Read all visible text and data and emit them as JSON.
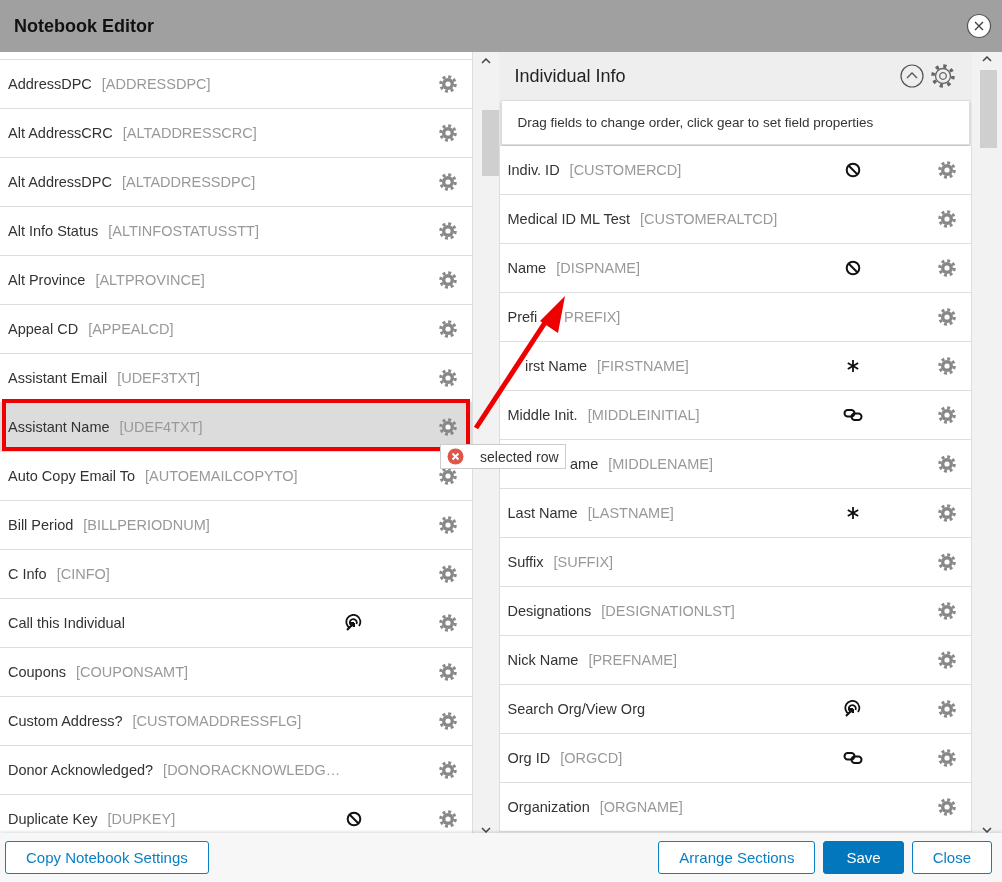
{
  "window": {
    "title": "Notebook Editor"
  },
  "available_fields": [
    {
      "label": "AddressDPC",
      "code": "[ADDRESSDPC]",
      "kind": "plain",
      "selected": false
    },
    {
      "label": "Alt AddressCRC",
      "code": "[ALTADDRESSCRC]",
      "kind": "plain",
      "selected": false
    },
    {
      "label": "Alt AddressDPC",
      "code": "[ALTADDRESSDPC]",
      "kind": "plain",
      "selected": false
    },
    {
      "label": "Alt Info Status",
      "code": "[ALTINFOSTATUSSTT]",
      "kind": "plain",
      "selected": false
    },
    {
      "label": "Alt Province",
      "code": "[ALTPROVINCE]",
      "kind": "plain",
      "selected": false
    },
    {
      "label": "Appeal CD",
      "code": "[APPEALCD]",
      "kind": "plain",
      "selected": false
    },
    {
      "label": "Assistant Email",
      "code": "[UDEF3TXT]",
      "kind": "plain",
      "selected": false
    },
    {
      "label": "Assistant Name",
      "code": "[UDEF4TXT]",
      "kind": "plain",
      "selected": true
    },
    {
      "label": "Auto Copy Email To",
      "code": "[AUTOEMAILCOPYTO]",
      "kind": "plain",
      "selected": false
    },
    {
      "label": "Bill Period",
      "code": "[BILLPERIODNUM]",
      "kind": "plain",
      "selected": false
    },
    {
      "label": "C Info",
      "code": "[CINFO]",
      "kind": "plain",
      "selected": false
    },
    {
      "label": "Call this Individual",
      "kind": "lookup",
      "selected": false
    },
    {
      "label": "Coupons",
      "code": "[COUPONSAMT]",
      "kind": "plain",
      "selected": false
    },
    {
      "label": "Custom Address?",
      "code": "[CUSTOMADDRESSFLG]",
      "kind": "plain",
      "selected": false
    },
    {
      "label": "Donor Acknowledged?",
      "code": "[DONORACKNOWLEDG…",
      "kind": "plain",
      "selected": false
    },
    {
      "label": "Duplicate Key",
      "code": "[DUPKEY]",
      "kind": "readonly",
      "selected": false
    }
  ],
  "section": {
    "title": "Individual Info",
    "expanded": true,
    "hint": "Drag fields to change order, click gear to set field properties",
    "fields": [
      {
        "label": "Indiv. ID",
        "code": "[CUSTOMERCD]",
        "kind": "readonly"
      },
      {
        "label": "Medical ID ML Test",
        "code": "[CUSTOMERALTCD]",
        "kind": "plain"
      },
      {
        "label": "Name",
        "code": "[DISPNAME]",
        "kind": "readonly"
      },
      {
        "label": "Prefi",
        "code": "PREFIX]",
        "kind": "plain"
      },
      {
        "label": "irst Name",
        "code": "[FIRSTNAME]",
        "kind": "required"
      },
      {
        "label": "Middle Init.",
        "code": "[MIDDLEINITIAL]",
        "kind": "linked"
      },
      {
        "label": "ame",
        "code": "[MIDDLENAME]",
        "kind": "plain"
      },
      {
        "label": "Last Name",
        "code": "[LASTNAME]",
        "kind": "required"
      },
      {
        "label": "Suffix",
        "code": "[SUFFIX]",
        "kind": "plain"
      },
      {
        "label": "Designations",
        "code": "[DESIGNATIONLST]",
        "kind": "plain"
      },
      {
        "label": "Nick Name",
        "code": "[PREFNAME]",
        "kind": "plain"
      },
      {
        "label": "Search Org/View Org",
        "kind": "lookup"
      },
      {
        "label": "Org ID",
        "code": "[ORGCD]",
        "kind": "linked"
      },
      {
        "label": "Organization",
        "code": "[ORGNAME]",
        "kind": "plain"
      }
    ]
  },
  "annotation": {
    "highlight": true,
    "arrow": true,
    "tooltip": "selected row"
  },
  "footer": {
    "left_buttons": [
      {
        "label": "Copy Notebook Settings",
        "kind": "outline"
      }
    ],
    "right_buttons": [
      {
        "label": "Arrange Sections",
        "kind": "outline"
      },
      {
        "label": "Save",
        "kind": "primary"
      },
      {
        "label": "Close",
        "kind": "outline"
      }
    ]
  }
}
